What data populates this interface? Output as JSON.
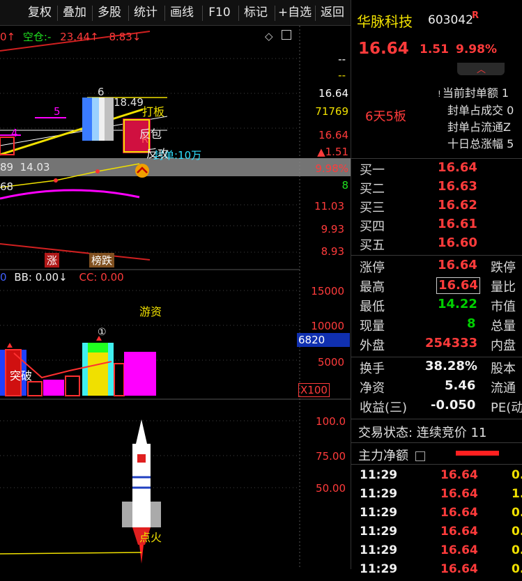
{
  "toolbar": {
    "items": [
      "复权",
      "叠加",
      "多股",
      "统计",
      "画线",
      "F10",
      "标记",
      "+自选",
      "返回"
    ]
  },
  "indicator_row1": {
    "prefix": "0↑",
    "label": "空仓:-",
    "v1": "23.44↑",
    "v2": "8.83↓"
  },
  "indicator_row2": {
    "prefix": "0",
    "bb": "BB: 0.00↓",
    "cc": "CC: 0.00"
  },
  "price_axis": {
    "top1": "--",
    "top2": "--",
    "price": "16.64",
    "volume": "71769",
    "price2": "16.64",
    "change": "▲1.51",
    "pct": "9.98%",
    "vol_now": "8",
    "lvl1": "11.03",
    "lvl2": "9.93",
    "lvl3": "8.93"
  },
  "volume_axis": {
    "v1": "15000",
    "v2": "10000",
    "current": "6820",
    "v3": "5000",
    "unit": "X100"
  },
  "lower_axis": {
    "v1": "100.0",
    "v2": "75.00",
    "v3": "50.00"
  },
  "chart_labels": {
    "wave6": "6",
    "wave5": "5",
    "wave4": "4",
    "high_val": "18.49",
    "dabang": "打板",
    "fanbao": "反包",
    "r_mark": "R",
    "seal_amount": "封单:10万",
    "fangong": "反攻",
    "low_vals": "89  14.03",
    "low_val2": "68",
    "zhang": "涨",
    "bangdie": "榜跌",
    "youzi": "游资",
    "tupo": "突破",
    "circle_mark": "①",
    "dianhuo": "点火"
  },
  "quote": {
    "name": "华脉科技",
    "code": "603042",
    "badge": "R",
    "price": "16.64",
    "change": "1.51",
    "pct": "9.98%",
    "streak": "6天5板",
    "seal_lines": [
      "当前封单额 1",
      "封单占成交 0",
      "封单占流通Z",
      "十日总涨幅 5"
    ],
    "bids": [
      {
        "label": "买一",
        "price": "16.64"
      },
      {
        "label": "买二",
        "price": "16.63"
      },
      {
        "label": "买三",
        "price": "16.62"
      },
      {
        "label": "买四",
        "price": "16.61"
      },
      {
        "label": "买五",
        "price": "16.60"
      }
    ],
    "stats": [
      {
        "label": "涨停",
        "value": "16.64",
        "right": "跌停",
        "color": "red"
      },
      {
        "label": "最高",
        "value": "16.64",
        "right": "量比",
        "color": "red"
      },
      {
        "label": "最低",
        "value": "14.22",
        "right": "市值",
        "color": "green"
      },
      {
        "label": "现量",
        "value": "8",
        "right": "总量",
        "color": "green"
      },
      {
        "label": "外盘",
        "value": "254333",
        "right": "内盘",
        "color": "red"
      }
    ],
    "fundamentals": [
      {
        "label": "换手",
        "value": "38.28%",
        "right": "股本"
      },
      {
        "label": "净资",
        "value": "5.46",
        "right": "流通"
      },
      {
        "label": "收益(三)",
        "value": "-0.050",
        "right": "PE(动"
      }
    ],
    "trade_status": "交易状态: 连续竞价 11",
    "main_net": "主力净额",
    "trades": [
      {
        "time": "11:29",
        "price": "16.64",
        "vol": "0."
      },
      {
        "time": "11:29",
        "price": "16.64",
        "vol": "1."
      },
      {
        "time": "11:29",
        "price": "16.64",
        "vol": "0."
      },
      {
        "time": "11:29",
        "price": "16.64",
        "vol": "0."
      },
      {
        "time": "11:29",
        "price": "16.64",
        "vol": "0."
      },
      {
        "time": "11:29",
        "price": "16.64",
        "vol": "0."
      }
    ]
  },
  "colors": {
    "up": "#ff3b3b",
    "down": "#00d000",
    "accent": "#f0e000",
    "magenta": "#ff00ff"
  }
}
